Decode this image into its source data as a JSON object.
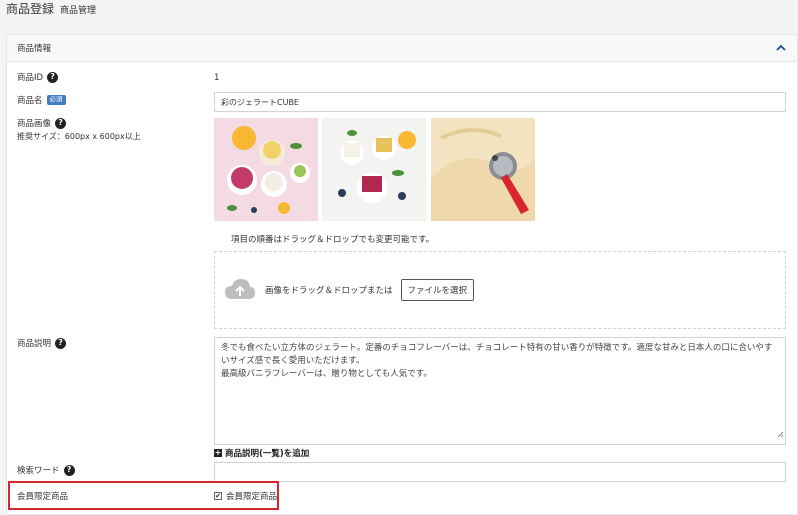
{
  "header": {
    "title": "商品登録",
    "subtitle": "商品管理"
  },
  "card": {
    "title": "商品情報"
  },
  "fields": {
    "product_id": {
      "label": "商品ID",
      "value": "1"
    },
    "product_name": {
      "label": "商品名",
      "badge": "必須",
      "value": "彩のジェラートCUBE"
    },
    "product_image": {
      "label": "商品画像",
      "recommend": "推奨サイズ：600px x 600px以上",
      "order_note": "項目の順番はドラッグ＆ドロップでも変更可能です。",
      "drop_text": "画像をドラッグ＆ドロップまたは",
      "file_button": "ファイルを選択"
    },
    "description": {
      "label": "商品説明",
      "lines": [
        "冬でも食べたい立方体のジェラート。定番のチョコフレーバーは、チョコレート特有の甘い香りが特徴です。適度な甘みと日本人の口に合いやす",
        "いサイズ感で長く愛用いただけます。",
        "最高級バニラフレーバーは、贈り物としても人気です。"
      ],
      "add_list_label": "商品説明(一覧)を追加"
    },
    "search_word": {
      "label": "検索ワード",
      "value": ""
    },
    "members_only": {
      "label": "会員限定商品",
      "checkbox_label": "会員限定商品",
      "checked": true
    }
  },
  "colors": {
    "badge": "#437ec4",
    "highlight": "#d9262c",
    "cloud": "#bdbdbd"
  },
  "icons": {
    "help": "?",
    "plus": "+",
    "check": "✔"
  }
}
